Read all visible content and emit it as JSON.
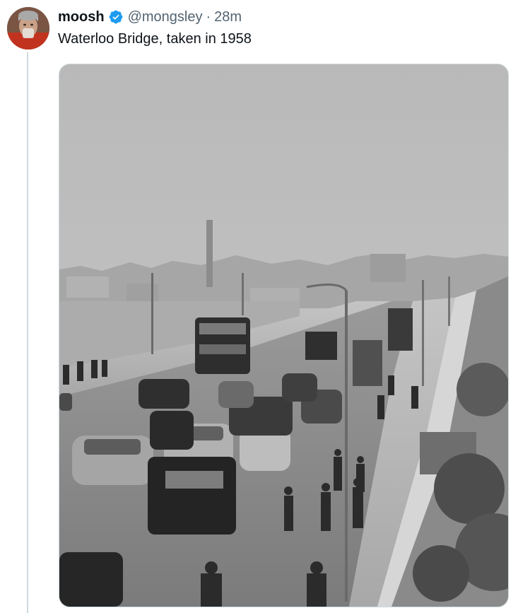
{
  "tweet": {
    "author_name": "moosh",
    "handle": "@mongsley",
    "separator": "·",
    "time": "28m",
    "text": "Waterloo Bridge, taken in 1958",
    "verified": true
  },
  "icons": {
    "verified_badge": "verified-badge-icon",
    "avatar": "profile-avatar"
  },
  "colors": {
    "verified_blue": "#1d9bf0",
    "handle_gray": "#536471",
    "thread_line": "#cfd9de"
  },
  "media": {
    "kind": "photo",
    "tone": "black-and-white"
  }
}
